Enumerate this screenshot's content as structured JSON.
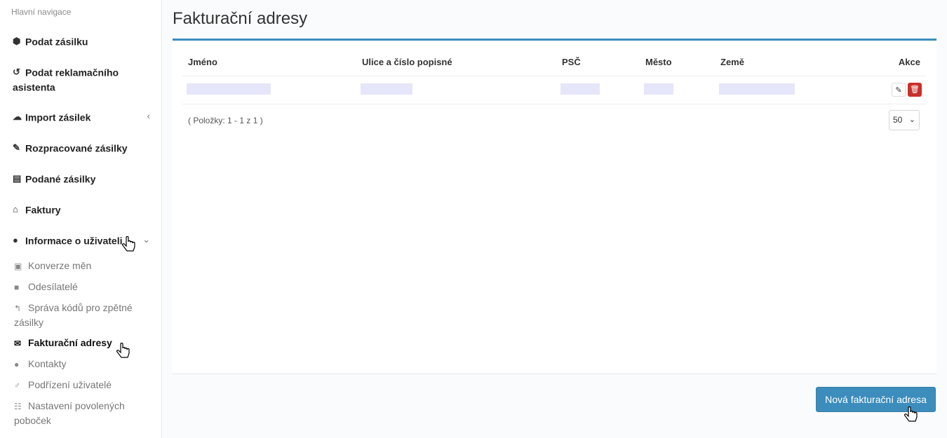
{
  "sidebar": {
    "header": "Hlavní navigace",
    "items": [
      {
        "label": "Podat zásilku",
        "icon": "cube-icon"
      },
      {
        "label": "Podat reklamačního asistenta",
        "icon": "undo-icon"
      },
      {
        "label": "Import zásilek",
        "icon": "cloud-upload-icon"
      },
      {
        "label": "Rozpracované zásilky",
        "icon": "edit-icon"
      },
      {
        "label": "Podané zásilky",
        "icon": "archive-icon"
      },
      {
        "label": "Faktury",
        "icon": "bank-icon"
      },
      {
        "label": "Informace o uživateli",
        "icon": "user-icon"
      }
    ],
    "subitems": [
      {
        "label": "Konverze měn",
        "icon": "money-icon"
      },
      {
        "label": "Odesílatelé",
        "icon": "cart-icon"
      },
      {
        "label": "Správa kódů pro zpětné zásilky",
        "icon": "reply-icon"
      },
      {
        "label": "Fakturační adresy",
        "icon": "envelope-icon"
      },
      {
        "label": "Kontakty",
        "icon": "users-icon"
      },
      {
        "label": "Podřízení uživatelé",
        "icon": "male-icon"
      },
      {
        "label": "Nastavení povolených poboček",
        "icon": "grid-icon"
      }
    ]
  },
  "main": {
    "title": "Fakturační adresy",
    "columns": [
      "Jméno",
      "Ulice a číslo popisné",
      "PSČ",
      "Město",
      "Země",
      "Akce"
    ],
    "pager_info": "( Položky: 1 - 1 z 1 )",
    "page_size": "50",
    "new_button": "Nová fakturační adresa"
  },
  "colors": {
    "accent": "#3c8dbc",
    "danger": "#c9302c"
  }
}
